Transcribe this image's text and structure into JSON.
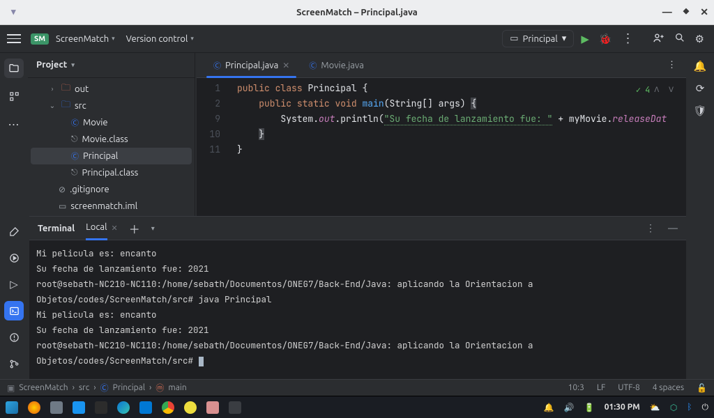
{
  "title": "ScreenMatch – Principal.java",
  "toolbar": {
    "project_badge": "SM",
    "project_name": "ScreenMatch",
    "version_control": "Version control",
    "run_config": "Principal"
  },
  "project_panel": {
    "title": "Project",
    "tree": {
      "out": "out",
      "src": "src",
      "movie_java": "Movie",
      "movie_class": "Movie.class",
      "principal_java": "Principal",
      "principal_class": "Principal.class",
      "gitignore": ".gitignore",
      "iml": "screenmatch.iml"
    }
  },
  "tabs": {
    "active": "Principal.java",
    "inactive": "Movie.java"
  },
  "code": {
    "line_numbers": [
      "1",
      "2",
      "9",
      "10",
      "11"
    ],
    "inspection_count": "4",
    "l1_public": "public",
    "l1_class": "class",
    "l1_name": " Principal {",
    "l2_public": "public",
    "l2_static": "static",
    "l2_void": "void",
    "l2_main": "main",
    "l2_args": "(String[] args) ",
    "l2_brace": "{",
    "l3_sys": "System.",
    "l3_out": "out",
    "l3_println": ".println(",
    "l3_str": "\"Su fecha de lanzamiento fue: \"",
    "l3_plus": " + myMovie.",
    "l3_field": "releaseDat",
    "l4_brace": "}",
    "l5_brace": "}"
  },
  "terminal": {
    "title": "Terminal",
    "tab": "Local",
    "output": "Mi pelicula es: encanto\nSu fecha de lanzamiento fue: 2021\nroot@sebath-NC210-NC110:/home/sebath/Documentos/ONEG7/Back-End/Java: aplicando la Orientacion a Objetos/codes/ScreenMatch/src# java Principal\nMi pelicula es: encanto\nSu fecha de lanzamiento fue: 2021\nroot@sebath-NC210-NC110:/home/sebath/Documentos/ONEG7/Back-End/Java: aplicando la Orientacion a Objetos/codes/ScreenMatch/src# "
  },
  "statusbar": {
    "root": "ScreenMatch",
    "src": "src",
    "cls": "Principal",
    "main": "main",
    "pos": "10:3",
    "lf": "LF",
    "enc": "UTF-8",
    "indent": "4 spaces"
  },
  "taskbar": {
    "time": "01:30 PM"
  }
}
